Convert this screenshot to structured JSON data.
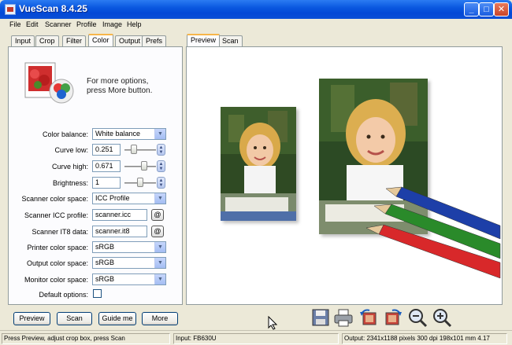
{
  "window": {
    "title": "VueScan 8.4.25"
  },
  "menu": [
    "File",
    "Edit",
    "Scanner",
    "Profile",
    "Image",
    "Help"
  ],
  "left_tabs": [
    "Input",
    "Crop",
    "Filter",
    "Color",
    "Output",
    "Prefs"
  ],
  "left_tabs_active": "Color",
  "preview_tabs": [
    "Preview",
    "Scan"
  ],
  "preview_tabs_active": "Preview",
  "info": {
    "line1": "For more options,",
    "line2": "press More button."
  },
  "fields": {
    "color_balance": {
      "label": "Color balance:",
      "value": "White balance"
    },
    "curve_low": {
      "label": "Curve low:",
      "value": "0.251",
      "level": 0.25
    },
    "curve_high": {
      "label": "Curve high:",
      "value": "0.671",
      "level": 0.67
    },
    "brightness": {
      "label": "Brightness:",
      "value": "1",
      "level": 0.5
    },
    "scanner_color_space": {
      "label": "Scanner color space:",
      "value": "ICC Profile"
    },
    "scanner_icc_profile": {
      "label": "Scanner ICC profile:",
      "value": "scanner.icc",
      "button": "@"
    },
    "scanner_it8_data": {
      "label": "Scanner IT8 data:",
      "value": "scanner.it8",
      "button": "@"
    },
    "printer_color_space": {
      "label": "Printer color space:",
      "value": "sRGB"
    },
    "output_color_space": {
      "label": "Output color space:",
      "value": "sRGB"
    },
    "monitor_color_space": {
      "label": "Monitor color space:",
      "value": "sRGB"
    },
    "default_options": {
      "label": "Default options:",
      "checked": false
    }
  },
  "buttons": {
    "preview": "Preview",
    "scan": "Scan",
    "guide": "Guide me",
    "more": "More"
  },
  "toolbar_icons": [
    "save-icon",
    "print-icon",
    "rotate-left-icon",
    "rotate-right-icon",
    "zoom-out-icon",
    "zoom-in-icon"
  ],
  "status": {
    "left": "Press Preview, adjust crop box, press Scan",
    "middle": "Input: FB630U",
    "right": "Output: 2341x1188 pixels 300 dpi 198x101 mm 4.17"
  },
  "colors": {
    "titlebar": "#0a58e0",
    "tab_highlight": "#f7b64a"
  }
}
